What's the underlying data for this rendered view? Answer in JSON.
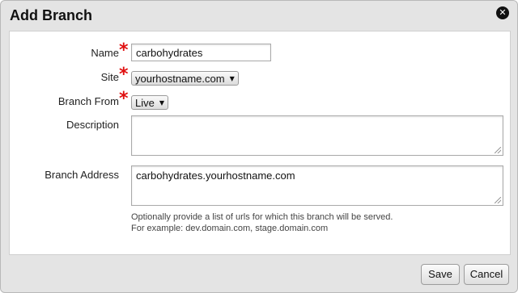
{
  "dialog": {
    "title": "Add Branch",
    "close_icon": "close-icon",
    "close_glyph": "✕"
  },
  "form": {
    "name": {
      "label": "Name",
      "required": true,
      "value": "carbohydrates"
    },
    "site": {
      "label": "Site",
      "required": true,
      "selected": "yourhostname.com"
    },
    "branch_from": {
      "label": "Branch From",
      "required": true,
      "selected": "Live"
    },
    "description": {
      "label": "Description",
      "value": ""
    },
    "branch_address": {
      "label": "Branch Address",
      "value": "carbohydrates.yourhostname.com",
      "hint_line1": "Optionally provide a list of urls for which this branch will be served.",
      "hint_line2": "For example: dev.domain.com, stage.domain.com"
    },
    "required_mark": "*",
    "select_arrow": "▼"
  },
  "footer": {
    "save_label": "Save",
    "cancel_label": "Cancel"
  },
  "colors": {
    "required": "#e01010",
    "dialog_bg": "#e4e4e4",
    "panel_bg": "#ffffff"
  }
}
